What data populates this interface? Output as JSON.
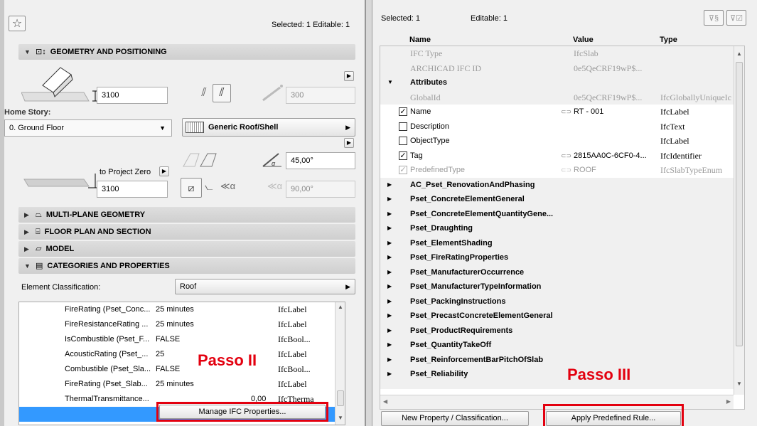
{
  "left": {
    "selected_text": "Selected: 1 Editable: 1",
    "sections": {
      "geometry": "GEOMETRY AND POSITIONING",
      "multiplane": "MULTI-PLANE GEOMETRY",
      "floorplan": "FLOOR PLAN AND SECTION",
      "model": "MODEL",
      "categories": "CATEGORIES AND PROPERTIES"
    },
    "thickness_value": "3100",
    "offset_value": "300",
    "home_story_label": "Home Story:",
    "home_story_value": "0. Ground Floor",
    "building_material": "Generic Roof/Shell",
    "angle_value": "45,00°",
    "to_project_zero_label": "to Project Zero",
    "project_zero_value": "3100",
    "angle2_value": "90,00°",
    "element_classification_label": "Element Classification:",
    "element_classification_value": "Roof",
    "properties": [
      {
        "name": "FireRating (Pset_Conc...",
        "value": "25 minutes",
        "type": "IfcLabel"
      },
      {
        "name": "FireResistanceRating ...",
        "value": "25 minutes",
        "type": "IfcLabel"
      },
      {
        "name": "IsCombustible (Pset_F...",
        "value": "FALSE",
        "type": "IfcBool..."
      },
      {
        "name": "AcousticRating (Pset_...",
        "value": "25",
        "type": "IfcLabel"
      },
      {
        "name": "Combustible (Pset_Sla...",
        "value": "FALSE",
        "type": "IfcBool..."
      },
      {
        "name": "FireRating (Pset_Slab...",
        "value": "25 minutes",
        "type": "IfcLabel"
      },
      {
        "name": "ThermalTransmittance...",
        "value": "0,00",
        "type": "IfcTherma"
      }
    ],
    "manage_button": "Manage IFC Properties...",
    "passo2": "Passo II"
  },
  "right": {
    "selected": "Selected: 1",
    "editable": "Editable: 1",
    "columns": {
      "name": "Name",
      "value": "Value",
      "type": "Type"
    },
    "top_rows": [
      {
        "name": "IFC Type",
        "value": "IfcSlab",
        "type": ""
      },
      {
        "name": "ARCHICAD IFC ID",
        "value": "0e5QeCRF19wP$...",
        "type": ""
      }
    ],
    "attributes_label": "Attributes",
    "attr_rows": [
      {
        "name": "GlobalId",
        "value": "0e5QeCRF19wP$...",
        "type": "IfcGloballyUniqueIc",
        "check": "",
        "gray": true
      },
      {
        "name": "Name",
        "value": "RT - 001",
        "type": "IfcLabel",
        "check": "✓",
        "gray": false
      },
      {
        "name": "Description",
        "value": "",
        "type": "IfcText",
        "check": "",
        "gray": false
      },
      {
        "name": "ObjectType",
        "value": "",
        "type": "IfcLabel",
        "check": "",
        "gray": false
      },
      {
        "name": "Tag",
        "value": "2815AA0C-6CF0-4...",
        "type": "IfcIdentifier",
        "check": "✓",
        "gray": false
      },
      {
        "name": "PredefinedType",
        "value": "ROOF",
        "type": "IfcSlabTypeEnum",
        "check": "✓",
        "gray": true
      }
    ],
    "psets": [
      "AC_Pset_RenovationAndPhasing",
      "Pset_ConcreteElementGeneral",
      "Pset_ConcreteElementQuantityGene...",
      "Pset_Draughting",
      "Pset_ElementShading",
      "Pset_FireRatingProperties",
      "Pset_ManufacturerOccurrence",
      "Pset_ManufacturerTypeInformation",
      "Pset_PackingInstructions",
      "Pset_PrecastConcreteElementGeneral",
      "Pset_ProductRequirements",
      "Pset_QuantityTakeOff",
      "Pset_ReinforcementBarPitchOfSlab",
      "Pset_Reliability"
    ],
    "new_property_button": "New Property / Classification...",
    "apply_rule_button": "Apply Predefined Rule...",
    "passo3": "Passo III"
  },
  "colors": {
    "highlight": "#e3000f",
    "selection": "#3399ff"
  }
}
